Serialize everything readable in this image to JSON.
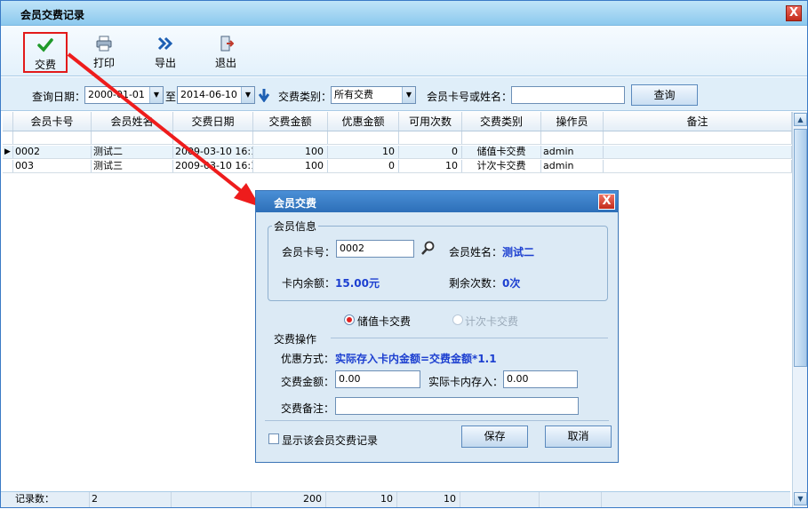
{
  "window": {
    "title": "会员交费记录",
    "close_label": "X"
  },
  "toolbar": {
    "pay_label": "交费",
    "print_label": "打印",
    "export_label": "导出",
    "exit_label": "退出"
  },
  "filter": {
    "date_label": "查询日期：",
    "date_from": "2000-01-01",
    "to_label": "至",
    "date_to": "2014-06-10",
    "type_label": "交费类别：",
    "type_value": "所有交费",
    "card_label": "会员卡号或姓名：",
    "card_value": "",
    "query_button": "查询"
  },
  "grid": {
    "columns": [
      "会员卡号",
      "会员姓名",
      "交费日期",
      "交费金额",
      "优惠金额",
      "可用次数",
      "交费类别",
      "操作员",
      "备注"
    ],
    "rows": [
      {
        "card": "0002",
        "name": "测试二",
        "date": "2009-03-10 16:1",
        "amount": "100",
        "discount": "10",
        "count": "0",
        "type": "储值卡交费",
        "operator": "admin",
        "note": ""
      },
      {
        "card": "003",
        "name": "测试三",
        "date": "2009-03-10 16:1",
        "amount": "100",
        "discount": "0",
        "count": "10",
        "type": "计次卡交费",
        "operator": "admin",
        "note": ""
      }
    ],
    "footer": {
      "label": "记录数：",
      "count": "2",
      "amount": "200",
      "discount": "10",
      "usable": "10"
    }
  },
  "dialog": {
    "title": "会员交费",
    "close_label": "X",
    "member_group": "会员信息",
    "card_label": "会员卡号：",
    "card_value": "0002",
    "name_label": "会员姓名：",
    "name_value": "测试二",
    "balance_label": "卡内余额：",
    "balance_value": "15.00元",
    "remain_label": "剩余次数：",
    "remain_value": "0次",
    "radio_stored": "储值卡交费",
    "radio_count": "计次卡交费",
    "op_group": "交费操作",
    "discount_label": "优惠方式：",
    "discount_value": "实际存入卡内金额=交费金额*1.1",
    "amount_label": "交费金额：",
    "amount_value": "0.00",
    "actual_label": "实际卡内存入：",
    "actual_value": "0.00",
    "note_label": "交费备注：",
    "note_value": "",
    "show_records_label": "显示该会员交费记录",
    "save_button": "保存",
    "cancel_button": "取消"
  },
  "colors": {
    "accent": "#2d6fb8",
    "highlight": "#e21a1a",
    "blue_text": "#1c3fd0"
  },
  "icons": {
    "pay": "check-icon",
    "print": "printer-icon",
    "export": "double-chevron-icon",
    "exit": "door-exit-icon",
    "search": "magnifier-icon"
  }
}
